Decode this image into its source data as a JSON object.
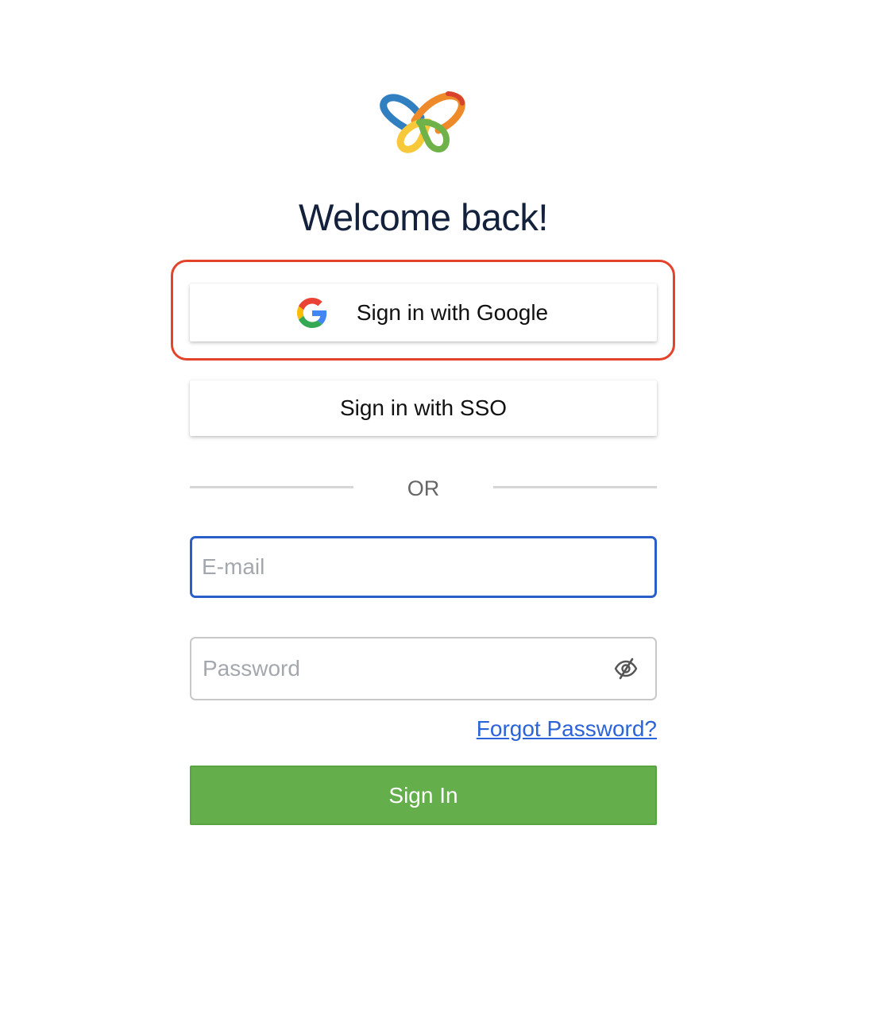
{
  "logo": {
    "icon": "knot-logo-icon",
    "colors": [
      "#2f7fc1",
      "#f2962a",
      "#f7c83a",
      "#6fb24a",
      "#d9432e"
    ]
  },
  "header": {
    "title": "Welcome back!"
  },
  "social": {
    "google_label": "Sign in with Google",
    "google_icon": "google-icon",
    "sso_label": "Sign in with SSO"
  },
  "divider": {
    "label": "OR"
  },
  "form": {
    "email": {
      "placeholder": "E-mail",
      "value": ""
    },
    "password": {
      "placeholder": "Password",
      "value": "",
      "toggle_icon": "eye-slash-icon"
    },
    "forgot_label": "Forgot Password?",
    "submit_label": "Sign In"
  },
  "colors": {
    "highlight": "#e2432a",
    "focus_border": "#2a5fc9",
    "link": "#2b63d9",
    "primary_button": "#64ae4c",
    "title": "#14213d"
  }
}
